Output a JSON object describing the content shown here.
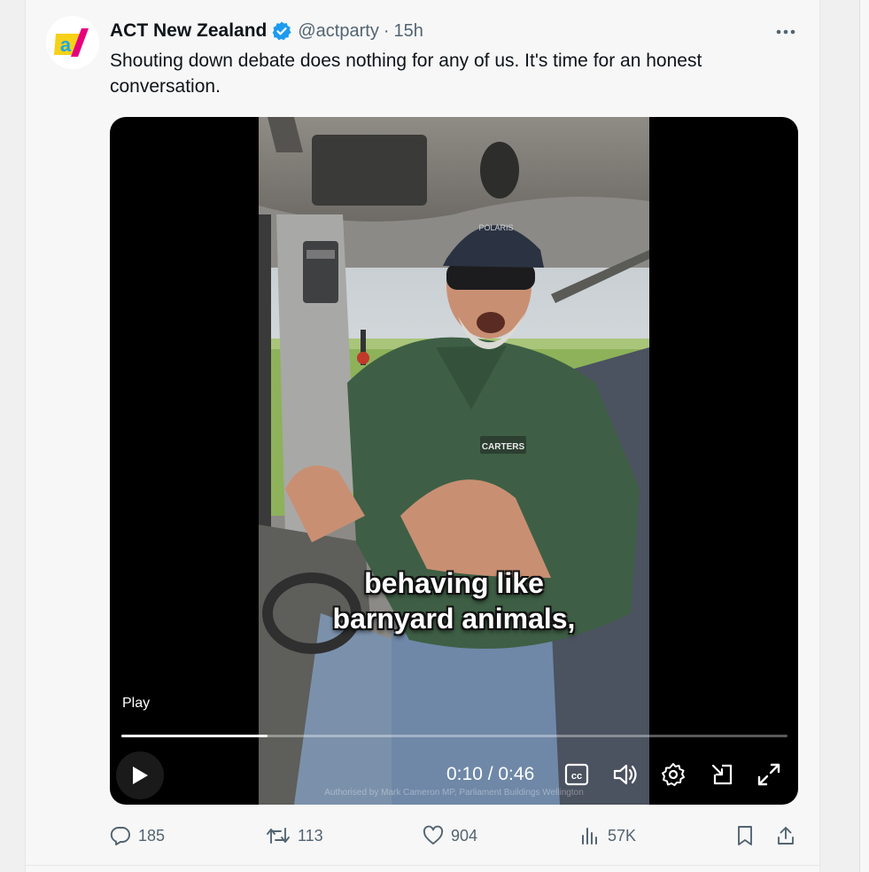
{
  "tweet": {
    "author_name": "ACT New Zealand",
    "handle": "@actparty",
    "separator": "·",
    "time": "15h",
    "text": "Shouting down debate does nothing for any of us. It's time for an honest conversation.",
    "avatar_icon": "act-party-logo",
    "avatar_letter": "a/"
  },
  "video": {
    "caption_line1": "behaving like",
    "caption_line2": "barnyard animals,",
    "authorised": "Authorised by Mark Cameron MP, Parliament Buildings Wellington",
    "play_label": "Play",
    "timecode": "0:10 / 0:46",
    "progress": 0.22,
    "shirt_logo": "CARTERS"
  },
  "actions": {
    "replies": "185",
    "reposts": "113",
    "likes": "904",
    "views": "57K"
  },
  "colors": {
    "verified": "#1d9bf0",
    "text": "#0f1419",
    "secondary": "#536471",
    "logo_yellow": "#f7d117",
    "logo_blue": "#1aa9e6",
    "logo_pink": "#e6007e"
  }
}
